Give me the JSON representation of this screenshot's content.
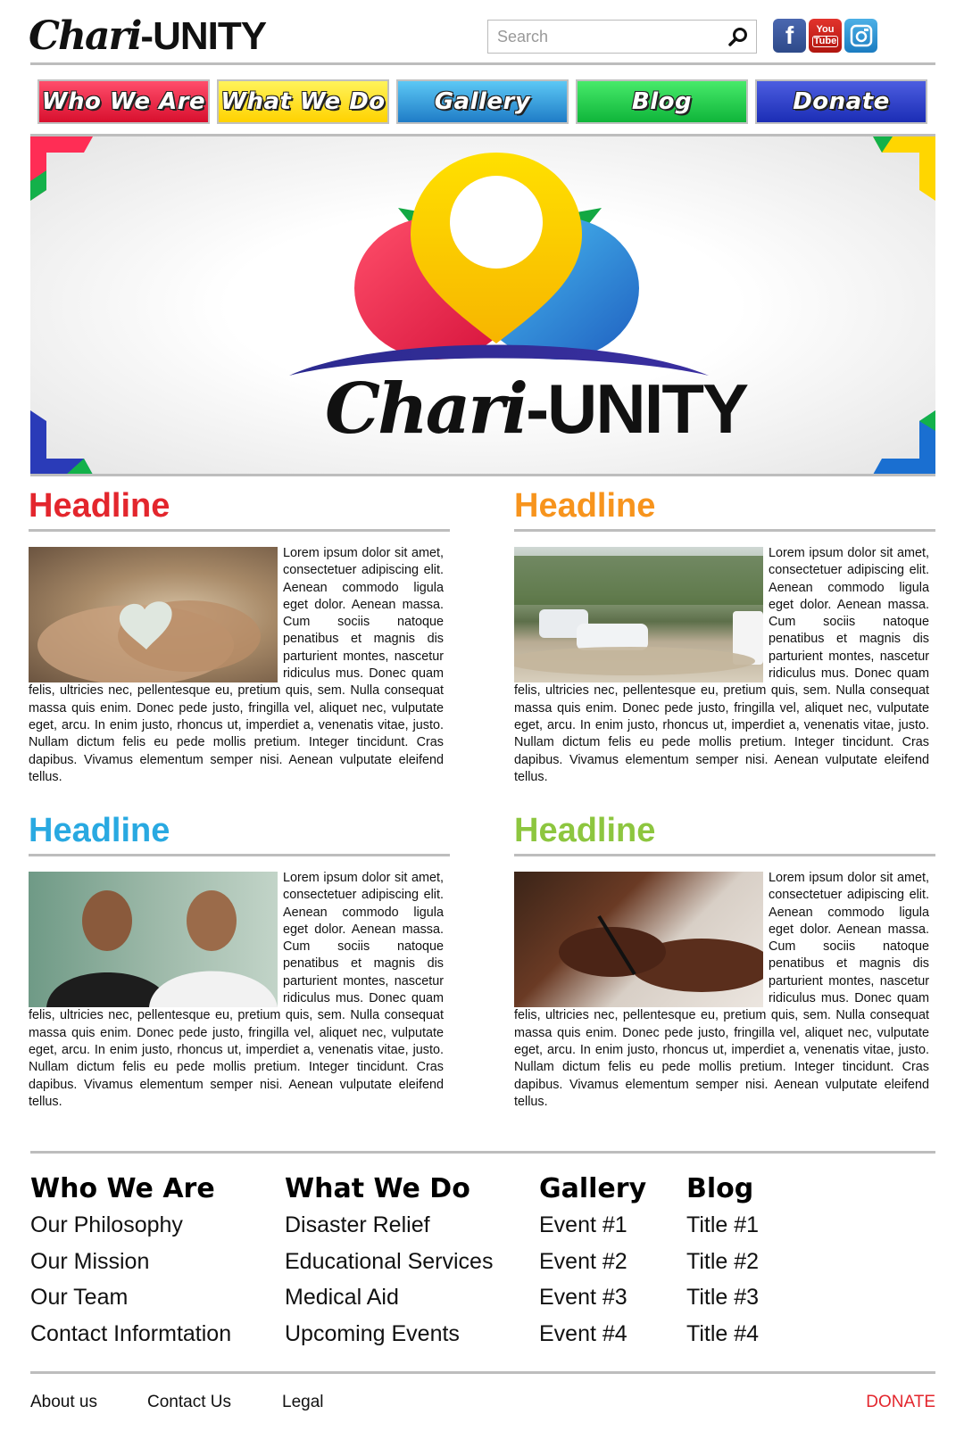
{
  "header": {
    "logo_script": "Chari",
    "logo_dash": "-",
    "logo_bold": "UNITY",
    "search_placeholder": "Search",
    "search_icon": "magnifier-icon",
    "social": [
      {
        "name": "facebook-icon",
        "label": "f"
      },
      {
        "name": "youtube-icon",
        "label_top": "You",
        "label_bottom": "Tube"
      },
      {
        "name": "instagram-icon"
      }
    ]
  },
  "nav": [
    "Who We Are",
    "What We Do",
    "Gallery",
    "Blog",
    "Donate"
  ],
  "hero": {
    "logo_script": "Chari",
    "logo_dash": "-",
    "logo_bold": "UNITY"
  },
  "articles": [
    {
      "headline": "Headline",
      "color": "#e3262d",
      "image": "hands-heart-photo",
      "body": "Lorem ipsum dolor sit amet, consectetuer adipiscing elit. Aenean commodo ligula eget dolor. Aenean massa. Cum sociis natoque penatibus et magnis dis parturient montes, nascetur ridiculus mus. Donec quam felis, ultricies nec, pellentesque eu, pretium quis, sem. Nulla consequat massa quis enim. Donec pede justo, fringilla vel, aliquet nec, vulputate eget, arcu. In enim justo, rhoncus ut, imperdiet a, venenatis vitae, justo. Nullam dictum felis eu pede mollis pretium. Integer tincidunt. Cras dapibus. Vivamus elementum semper nisi. Aenean vulputate eleifend tellus."
    },
    {
      "headline": "Headline",
      "color": "#f7941d",
      "image": "flooded-street-photo",
      "body": "Lorem ipsum dolor sit amet, consectetuer adipiscing elit. Aenean commodo ligula eget dolor. Aenean massa. Cum sociis natoque penatibus et magnis dis parturient montes, nascetur ridiculus mus. Donec quam felis, ultricies nec, pellentesque eu, pretium quis, sem. Nulla consequat massa quis enim. Donec pede justo, fringilla vel, aliquet nec, vulputate eget, arcu. In enim justo, rhoncus ut, imperdiet a, venenatis vitae, justo. Nullam dictum felis eu pede mollis pretium. Integer tincidunt. Cras dapibus. Vivamus elementum semper nisi. Aenean vulputate eleifend tellus."
    },
    {
      "headline": "Headline",
      "color": "#29a9e1",
      "image": "two-people-photo",
      "body": "Lorem ipsum dolor sit amet, consectetuer adipiscing elit. Aenean commodo ligula eget dolor. Aenean massa. Cum sociis natoque penatibus et magnis dis parturient montes, nascetur ridiculus mus. Donec quam felis, ultricies nec, pellentesque eu, pretium quis, sem. Nulla consequat massa quis enim. Donec pede justo, fringilla vel, aliquet nec, vulputate eget, arcu. In enim justo, rhoncus ut, imperdiet a, venenatis vitae, justo. Nullam dictum felis eu pede mollis pretium. Integer tincidunt. Cras dapibus. Vivamus elementum semper nisi. Aenean vulputate eleifend tellus."
    },
    {
      "headline": "Headline",
      "color": "#8dc63f",
      "image": "hands-writing-photo",
      "body": "Lorem ipsum dolor sit amet, consectetuer adipiscing elit. Aenean commodo ligula eget dolor. Aenean massa. Cum sociis natoque penatibus et magnis dis parturient montes, nascetur ridiculus mus. Donec quam felis, ultricies nec, pellentesque eu, pretium quis, sem. Nulla consequat massa quis enim. Donec pede justo, fringilla vel, aliquet nec, vulputate eget, arcu. In enim justo, rhoncus ut, imperdiet a, venenatis vitae, justo. Nullam dictum felis eu pede mollis pretium. Integer tincidunt. Cras dapibus. Vivamus elementum semper nisi. Aenean vulputate eleifend tellus."
    }
  ],
  "footer": {
    "columns": [
      {
        "heading": "Who We Are",
        "links": [
          "Our Philosophy",
          "Our Mission",
          "Our Team",
          "Contact Informtation"
        ]
      },
      {
        "heading": "What We Do",
        "links": [
          "Disaster Relief",
          "Educational Services",
          "Medical Aid",
          "Upcoming Events"
        ]
      },
      {
        "heading": "Gallery",
        "links": [
          "Event #1",
          "Event #2",
          "Event #3",
          "Event #4"
        ]
      },
      {
        "heading": "Blog",
        "links": [
          "Title #1",
          "Title #2",
          "Title #3",
          "Title #4"
        ]
      }
    ],
    "bottom_links": [
      "About us",
      "Contact Us",
      "Legal"
    ],
    "donate": "DONATE",
    "donate_color": "#e3262d"
  }
}
